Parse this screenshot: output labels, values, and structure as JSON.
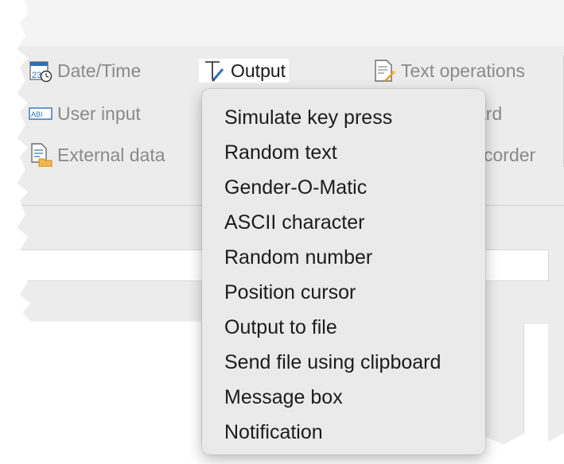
{
  "ribbon": {
    "buttons": [
      {
        "label": "Date/Time",
        "icon": "calendar-clock-icon"
      },
      {
        "label": "Output",
        "icon": "text-cursor-pen-icon",
        "active": true
      },
      {
        "label": "Text operations",
        "icon": "document-wand-icon"
      },
      {
        "label": "User input",
        "icon": "abi-input-icon"
      },
      {
        "label": "External data",
        "icon": "document-folder-icon"
      }
    ],
    "partial_labels": [
      "ard",
      "corder"
    ]
  },
  "output_menu": {
    "items": [
      "Simulate key press",
      "Random text",
      "Gender-O-Matic",
      "ASCII character",
      "Random number",
      "Position cursor",
      "Output to file",
      "Send file using clipboard",
      "Message box",
      "Notification"
    ]
  },
  "colors": {
    "window_bg": "#ececec",
    "menu_bg": "#eaeaea",
    "label_gray": "#8a8a8a",
    "text_dark": "#1c1c1c",
    "icon_blue": "#2f6fb8",
    "icon_orange": "#e59a2f"
  }
}
